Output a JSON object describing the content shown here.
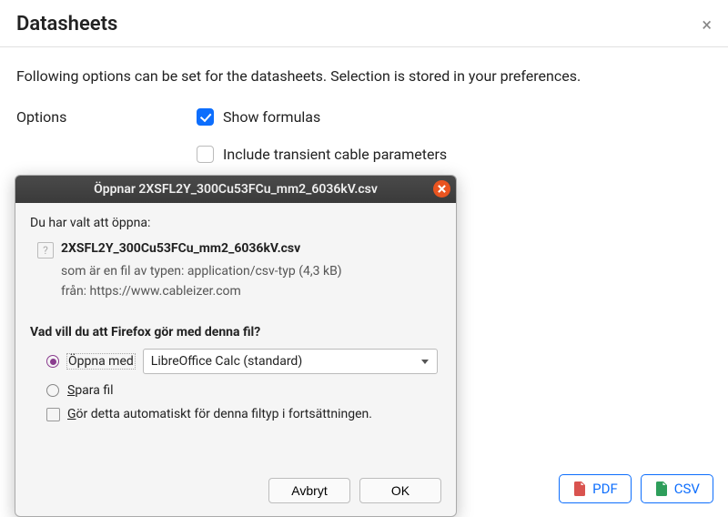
{
  "header": {
    "title": "Datasheets"
  },
  "intro": "Following options can be set for the datasheets. Selection is stored in your preferences.",
  "options": {
    "label": "Options",
    "show_formulas": "Show formulas",
    "include_transient": "Include transient cable parameters"
  },
  "buttons": {
    "pdf": "PDF",
    "csv": "CSV"
  },
  "dialog": {
    "title": "Öppnar 2XSFL2Y_300Cu53FCu_mm2_6036kV.csv",
    "you_chose": "Du har valt att öppna:",
    "file_name": "2XSFL2Y_300Cu53FCu_mm2_6036kV.csv",
    "type_line": "som är en fil av typen: application/csv-typ (4,3 kB)",
    "from_line": "från: https://www.cableizer.com",
    "question": "Vad vill du att Firefox gör med denna fil?",
    "open_with_pre": "Ö",
    "open_with_rest": "ppna med",
    "open_app": "LibreOffice Calc (standard)",
    "save_pre": "S",
    "save_rest": "para fil",
    "auto_pre": "G",
    "auto_rest": "ör detta automatiskt för denna filtyp i fortsättningen.",
    "cancel": "Avbryt",
    "ok": "OK"
  }
}
